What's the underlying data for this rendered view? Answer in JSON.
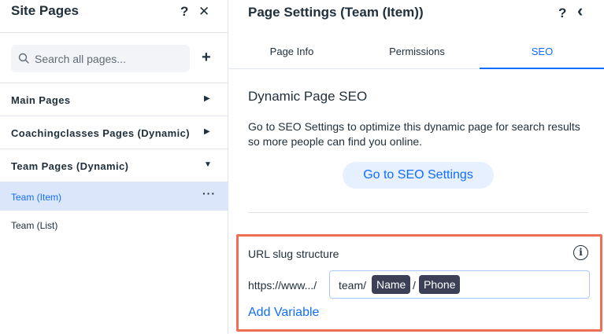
{
  "left_panel": {
    "title": "Site Pages",
    "help_icon": "?",
    "close_icon": "✕",
    "search": {
      "placeholder": "Search all pages...",
      "value": ""
    },
    "add_icon": "+",
    "sections": [
      {
        "label": "Main Pages",
        "arrow": "▶"
      },
      {
        "label": "Coachingclasses Pages (Dynamic)",
        "arrow": "▶"
      },
      {
        "label": "Team Pages (Dynamic)",
        "arrow": "▼"
      }
    ],
    "pages": [
      {
        "label": "Team (Item)",
        "selected": true,
        "more": "···"
      },
      {
        "label": "Team (List)",
        "selected": false
      }
    ]
  },
  "right_panel": {
    "title": "Page Settings (Team (Item))",
    "help_icon": "?",
    "back_icon": "‹",
    "tabs": [
      {
        "label": "Page Info"
      },
      {
        "label": "Permissions"
      },
      {
        "label": "SEO",
        "active": true
      }
    ],
    "section_title": "Dynamic Page SEO",
    "description": "Go to SEO Settings to optimize this dynamic page for search results so more people can find you online.",
    "seo_button": "Go to SEO Settings",
    "url_slug": {
      "label": "URL slug structure",
      "info_icon": "i",
      "prefix": "https://www.../",
      "static_part": "team/",
      "variables": [
        "Name",
        "Phone"
      ],
      "separator": "/",
      "add_variable": "Add Variable"
    }
  },
  "colors": {
    "accent": "#116dff",
    "highlight_border": "#ef6f56",
    "selected_bg": "#dce6fb",
    "chip_bg": "#3b4057"
  }
}
